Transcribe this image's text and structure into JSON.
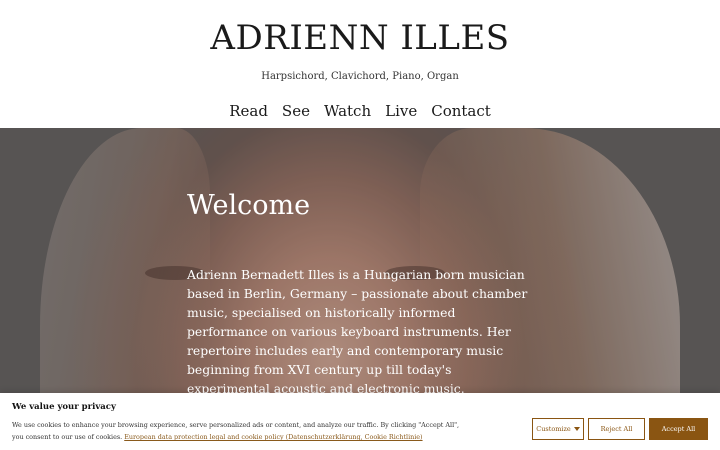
{
  "header": {
    "title": "ADRIENN ILLES",
    "tagline": "Harpsichord, Clavichord, Piano, Organ",
    "nav": [
      "Read",
      "See",
      "Watch",
      "Live",
      "Contact"
    ]
  },
  "hero": {
    "heading": "Welcome",
    "text": "Adrienn Bernadett Illes is a Hungarian born musician based in Berlin, Germany – passionate about chamber music, specialised on historically informed performance on various keyboard instruments. Her repertoire includes early and contemporary music beginning from XVI century up till today's experimental acoustic and electronic music."
  },
  "cookie": {
    "title": "We value your privacy",
    "text": "We use cookies to enhance your browsing experience, serve personalized ads or content, and analyze our traffic. By clicking \"Accept All\", you consent to our use of cookies.",
    "link": "European data protection legal and cookie policy (Datenschutzerklärung, Cookie Richtlinie)",
    "customize": "Customize",
    "reject": "Reject All",
    "accept": "Accept All"
  },
  "colors": {
    "accent": "#8a5512"
  }
}
